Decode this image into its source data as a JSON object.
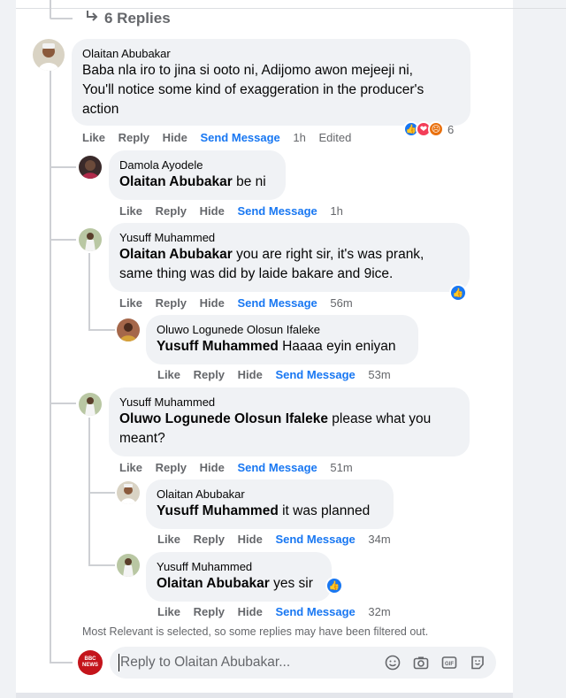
{
  "replies_toggle": {
    "label": "6 Replies"
  },
  "comments": [
    {
      "author": "Olaitan Abubakar",
      "text_lines": [
        "Baba nla iro to jina si ooto ni, Adijomo awon mejeeji ni,",
        "You'll notice some kind of exaggeration in the producer's",
        "action"
      ],
      "actions": {
        "like": "Like",
        "reply": "Reply",
        "hide": "Hide",
        "send": "Send Message",
        "time": "1h",
        "edited": "Edited"
      },
      "reaction_count": "6"
    },
    {
      "author": "Damola Ayodele",
      "mention": "Olaitan Abubakar",
      "text": " be ni",
      "actions": {
        "like": "Like",
        "reply": "Reply",
        "hide": "Hide",
        "send": "Send Message",
        "time": "1h"
      }
    },
    {
      "author": "Yusuff Muhammed",
      "mention": "Olaitan Abubakar",
      "text_lines": [
        " you are right sir, it's was prank,",
        "same thing was did by laide bakare and 9ice."
      ],
      "actions": {
        "like": "Like",
        "reply": "Reply",
        "hide": "Hide",
        "send": "Send Message",
        "time": "56m"
      }
    },
    {
      "author": "Oluwo Logunede Olosun Ifaleke",
      "mention": "Yusuff Muhammed",
      "text": " Haaaa eyin eniyan",
      "actions": {
        "like": "Like",
        "reply": "Reply",
        "hide": "Hide",
        "send": "Send Message",
        "time": "53m"
      }
    },
    {
      "author": "Yusuff Muhammed",
      "mention": "Oluwo Logunede Olosun Ifaleke",
      "text_lines": [
        " please what you",
        "meant?"
      ],
      "actions": {
        "like": "Like",
        "reply": "Reply",
        "hide": "Hide",
        "send": "Send Message",
        "time": "51m"
      }
    },
    {
      "author": "Olaitan Abubakar",
      "mention": "Yusuff Muhammed",
      "text": " it was planned",
      "actions": {
        "like": "Like",
        "reply": "Reply",
        "hide": "Hide",
        "send": "Send Message",
        "time": "34m"
      }
    },
    {
      "author": "Yusuff Muhammed",
      "mention": "Olaitan Abubakar",
      "text": " yes sir",
      "actions": {
        "like": "Like",
        "reply": "Reply",
        "hide": "Hide",
        "send": "Send Message",
        "time": "32m"
      }
    }
  ],
  "filter_note": "Most Relevant is selected, so some replies may have been filtered out.",
  "reply_box": {
    "placeholder": "Reply to Olaitan Abubakar...",
    "avatar_text": "BBC NEWS",
    "icons": [
      "emoji-icon",
      "camera-icon",
      "gif-icon",
      "sticker-icon"
    ]
  },
  "colors": {
    "link": "#1877f2",
    "bubble": "#f0f2f5",
    "muted": "#65676b",
    "like": "#1877f2",
    "love": "#f33e58",
    "angry": "#e9710f"
  }
}
